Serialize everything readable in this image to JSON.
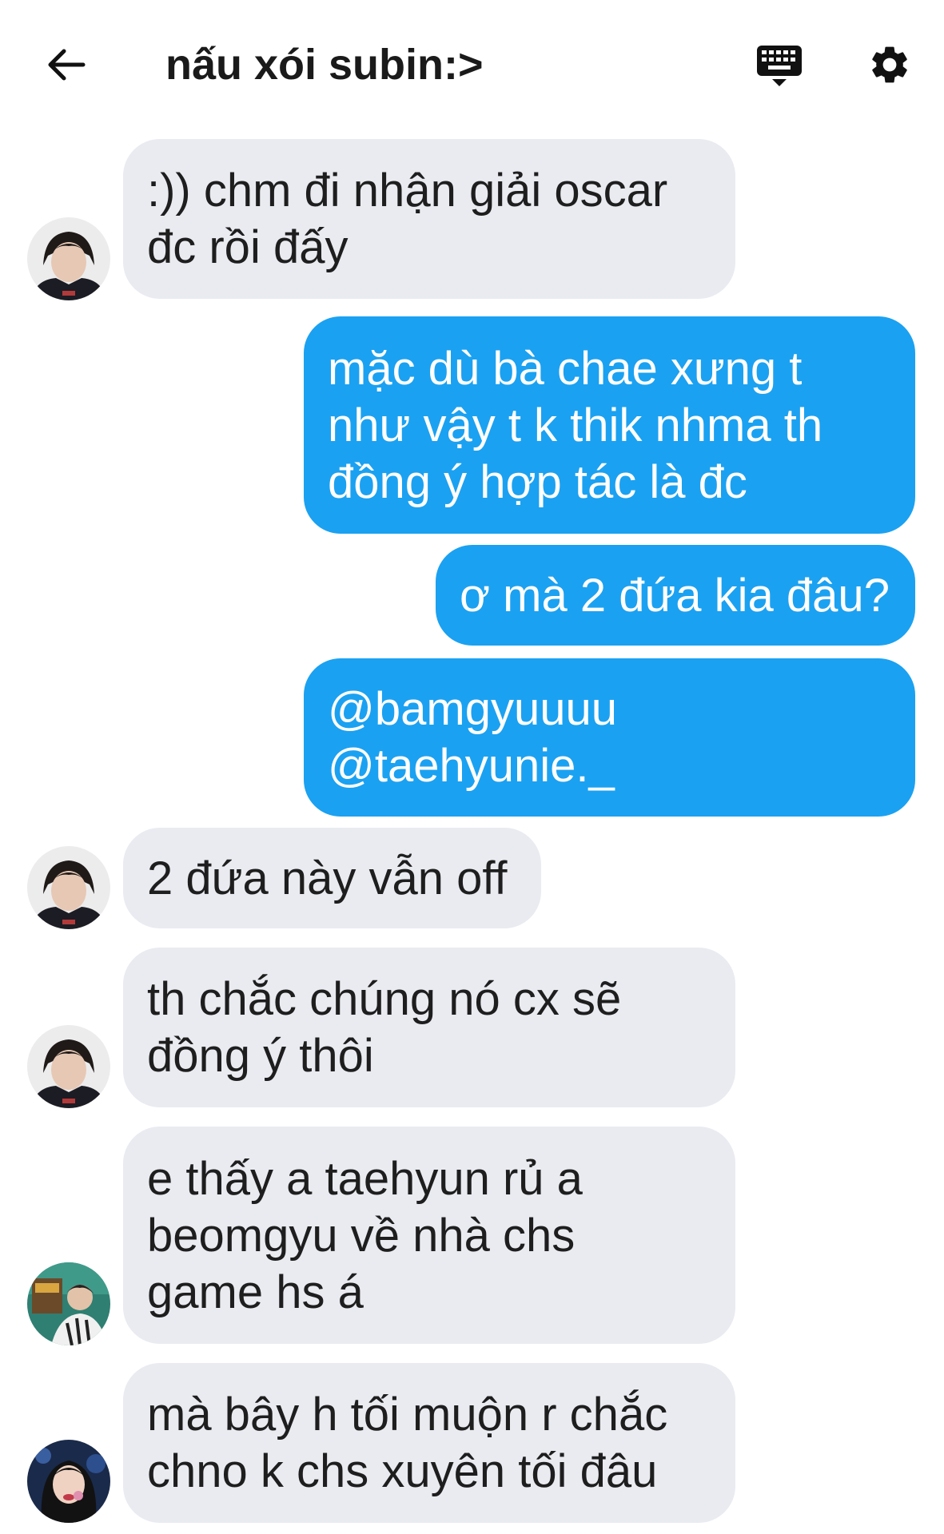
{
  "header": {
    "title": "nấu xói subin:>",
    "back_icon": "arrow-left-icon",
    "keyboard_icon": "keyboard-icon",
    "settings_icon": "gear-icon"
  },
  "colors": {
    "sent_bubble": "#1ba1f1",
    "received_bubble": "#e9ebf0",
    "background": "#ffffff"
  },
  "messages": [
    {
      "from": "them",
      "lines": [
        ":)) chm đi nhận giải oscar",
        "đc rồi đấy"
      ]
    },
    {
      "from": "me",
      "lines": [
        "mặc dù bà chae xưng t",
        "như vậy t k thik nhma th",
        "đồng ý hợp tác là đc"
      ]
    },
    {
      "from": "me",
      "lines": [
        "ơ mà 2 đứa kia đâu?"
      ]
    },
    {
      "from": "me",
      "lines": [
        "@bamgyuuuu",
        "@taehyunie._"
      ]
    },
    {
      "from": "them",
      "lines": [
        "2 đứa này vẫn off"
      ]
    },
    {
      "from": "them",
      "lines": [
        "th chắc chúng nó cx sẽ",
        "đồng ý thôi"
      ]
    },
    {
      "from": "them",
      "lines": [
        "e thấy a taehyun rủ a",
        "beomgyu về nhà chs",
        "game hs á"
      ]
    },
    {
      "from": "them",
      "lines": [
        "mà bây h tối muộn r chắc",
        "chno k chs xuyên tối đâu"
      ]
    }
  ]
}
